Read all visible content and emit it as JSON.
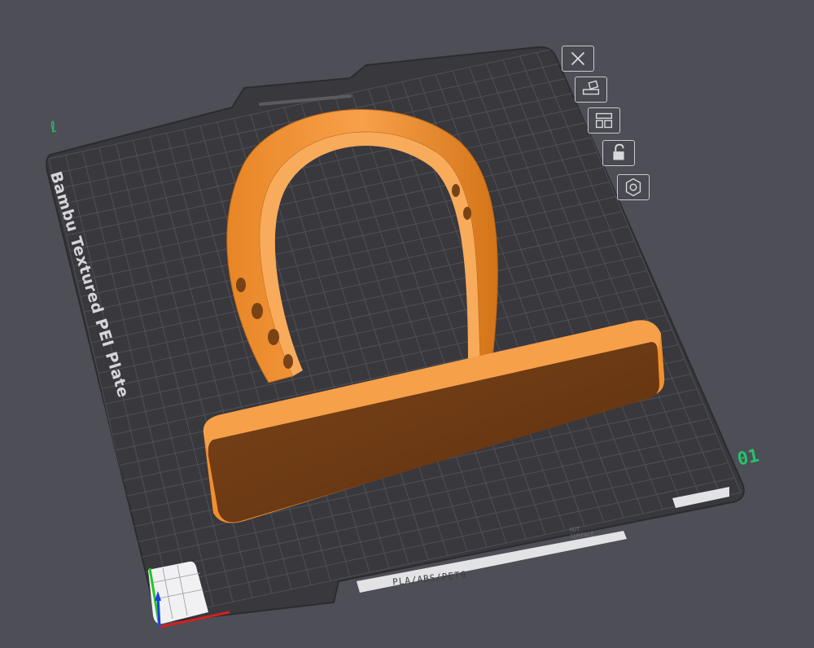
{
  "plate": {
    "name": "Bambu Textured PEI Plate",
    "number": "01",
    "origin_mark": "ℓ",
    "material_badge": "PLA/ABS/PETG",
    "hot_surface_line1": "HOT",
    "hot_surface_line2": "SURFACE"
  },
  "plate_tools": [
    {
      "icon": "close-icon"
    },
    {
      "icon": "auto-orient-icon"
    },
    {
      "icon": "arrange-icon"
    },
    {
      "icon": "lock-icon"
    },
    {
      "icon": "plate-settings-icon"
    }
  ],
  "colors": {
    "background": "#4e4e56",
    "plate": "#3a3a3f",
    "grid": "#4e4e54",
    "model": "#f28f2c",
    "model_shadow": "#6b3a12",
    "axis_x": "#d42020",
    "axis_y": "#22c822",
    "axis_z": "#2040e0",
    "accent_green": "#27c26a"
  }
}
